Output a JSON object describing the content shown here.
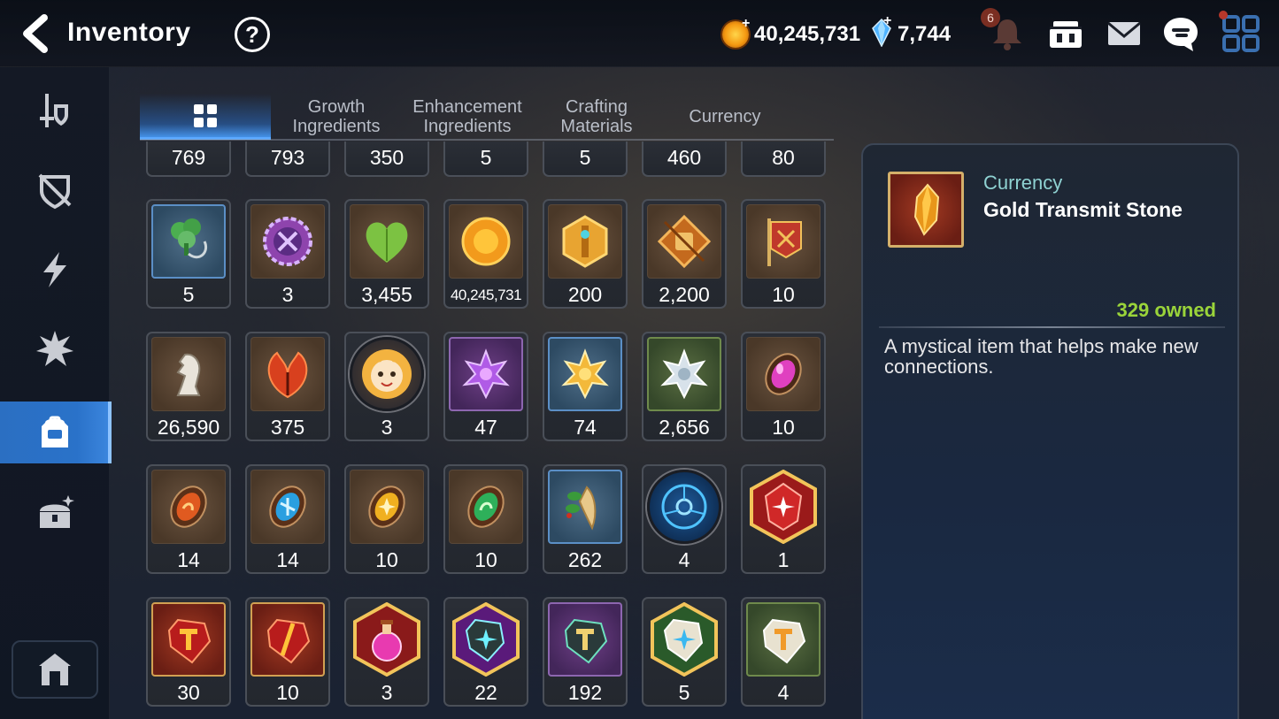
{
  "header": {
    "title": "Inventory",
    "help_label": "?",
    "gold_amount": "40,245,731",
    "crystal_amount": "7,744",
    "notification_count": "6",
    "plus_glyph": "+"
  },
  "sidenav": {
    "items": [
      {
        "name": "equipment",
        "active": false
      },
      {
        "name": "artifacts",
        "active": false
      },
      {
        "name": "catalysts",
        "active": false
      },
      {
        "name": "sets",
        "active": false
      },
      {
        "name": "materials",
        "active": true
      },
      {
        "name": "chest",
        "active": false
      }
    ]
  },
  "tabs": [
    {
      "label": "",
      "active": true
    },
    {
      "label": "Growth\nIngredients",
      "active": false
    },
    {
      "label": "Enhancement\nIngredients",
      "active": false
    },
    {
      "label": "Crafting\nMaterials",
      "active": false
    },
    {
      "label": "Currency",
      "active": false
    }
  ],
  "items_top_partial": [
    "769",
    "793",
    "350",
    "5",
    "5",
    "460",
    "80"
  ],
  "items": [
    [
      {
        "qty": "5",
        "icon": "clover-pendant",
        "rarity": "blue"
      },
      {
        "qty": "3",
        "icon": "purple-seal",
        "rarity": "brown"
      },
      {
        "qty": "3,455",
        "icon": "green-heart",
        "rarity": "brown"
      },
      {
        "qty": "40,245,731",
        "icon": "gold-coin",
        "rarity": "brown"
      },
      {
        "qty": "200",
        "icon": "gold-emblem",
        "rarity": "brown"
      },
      {
        "qty": "2,200",
        "icon": "fist-emblem",
        "rarity": "brown"
      },
      {
        "qty": "10",
        "icon": "war-banner",
        "rarity": "brown"
      }
    ],
    [
      {
        "qty": "26,590",
        "icon": "horse-statue",
        "rarity": "brown"
      },
      {
        "qty": "375",
        "icon": "red-leaf",
        "rarity": "brown"
      },
      {
        "qty": "3",
        "icon": "character-portrait",
        "rarity": "circle"
      },
      {
        "qty": "47",
        "icon": "purple-lotus",
        "rarity": "purple"
      },
      {
        "qty": "74",
        "icon": "gold-lotus",
        "rarity": "blue"
      },
      {
        "qty": "2,656",
        "icon": "silver-lotus",
        "rarity": "green"
      },
      {
        "qty": "10",
        "icon": "pink-gem",
        "rarity": "brown"
      }
    ],
    [
      {
        "qty": "14",
        "icon": "fire-rune",
        "rarity": "brown"
      },
      {
        "qty": "14",
        "icon": "ice-rune",
        "rarity": "brown"
      },
      {
        "qty": "10",
        "icon": "light-rune",
        "rarity": "brown"
      },
      {
        "qty": "10",
        "icon": "earth-rune",
        "rarity": "brown"
      },
      {
        "qty": "262",
        "icon": "herb-root",
        "rarity": "blue"
      },
      {
        "qty": "4",
        "icon": "blue-circuit",
        "rarity": "circle"
      },
      {
        "qty": "1",
        "icon": "red-star-hex",
        "rarity": "hex"
      }
    ],
    [
      {
        "qty": "30",
        "icon": "gold-transmit-stone",
        "rarity": "red"
      },
      {
        "qty": "10",
        "icon": "red-transmit-stone",
        "rarity": "red"
      },
      {
        "qty": "3",
        "icon": "love-potion",
        "rarity": "hex"
      },
      {
        "qty": "22",
        "icon": "cyan-star-hex",
        "rarity": "hex"
      },
      {
        "qty": "192",
        "icon": "purple-stone",
        "rarity": "purple"
      },
      {
        "qty": "5",
        "icon": "white-star-hex",
        "rarity": "hex"
      },
      {
        "qty": "4",
        "icon": "white-stone",
        "rarity": "green"
      }
    ]
  ],
  "detail": {
    "category": "Currency",
    "name": "Gold Transmit Stone",
    "owned": "329 owned",
    "description": "A mystical item that helps make new connections."
  },
  "colors": {
    "accent_blue": "#2a72c9",
    "owned_green": "#9ad43a",
    "category_teal": "#8fd2d2"
  }
}
